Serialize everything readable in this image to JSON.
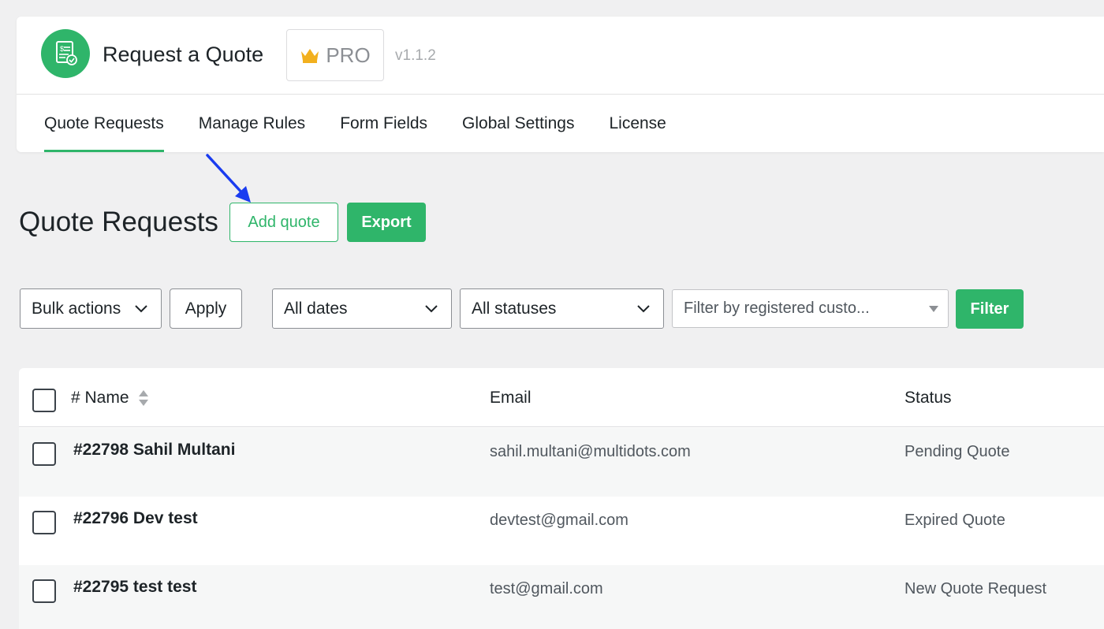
{
  "header": {
    "app_title": "Request a Quote",
    "badge": "PRO",
    "version": "v1.1.2",
    "brand_color": "#2fb56a"
  },
  "nav": {
    "tabs": [
      {
        "label": "Quote Requests",
        "active": true
      },
      {
        "label": "Manage Rules",
        "active": false
      },
      {
        "label": "Form Fields",
        "active": false
      },
      {
        "label": "Global Settings",
        "active": false
      },
      {
        "label": "License",
        "active": false
      }
    ]
  },
  "page": {
    "title": "Quote Requests",
    "add_label": "Add quote",
    "export_label": "Export"
  },
  "filters": {
    "bulk_actions": "Bulk actions",
    "apply_label": "Apply",
    "dates": "All dates",
    "statuses": "All statuses",
    "customer_placeholder": "Filter by registered custo...",
    "filter_label": "Filter"
  },
  "table": {
    "columns": [
      "# Name",
      "Email",
      "Status"
    ],
    "rows": [
      {
        "name": "#22798 Sahil Multani",
        "email": "sahil.multani@multidots.com",
        "status": "Pending Quote"
      },
      {
        "name": "#22796 Dev test",
        "email": "devtest@gmail.com",
        "status": "Expired Quote"
      },
      {
        "name": "#22795 test test",
        "email": "test@gmail.com",
        "status": "New Quote Request"
      }
    ]
  },
  "icons": {
    "logo": "quote-document-icon",
    "badge": "crown-icon",
    "sort": "sort-arrows-icon",
    "dropdown": "chevron-down-icon",
    "annotation": "arrow-annotation-icon"
  }
}
